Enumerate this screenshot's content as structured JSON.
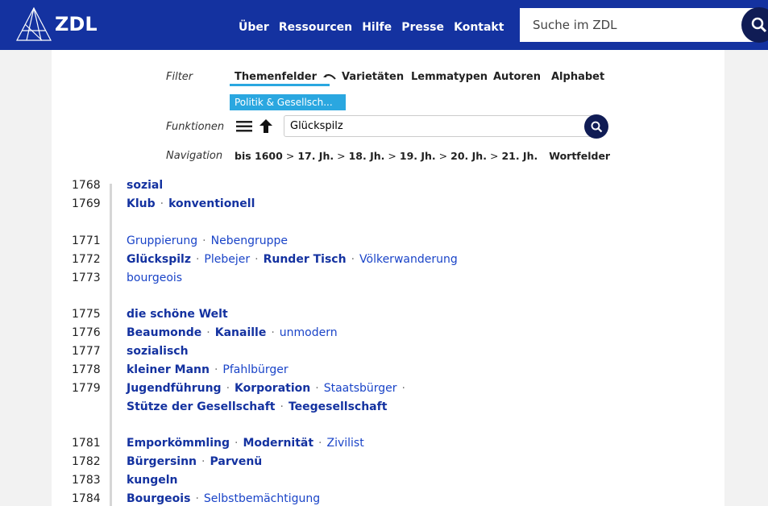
{
  "header": {
    "brand": "ZDL",
    "nav": [
      "Über",
      "Ressourcen",
      "Hilfe",
      "Presse",
      "Kontakt"
    ],
    "search_placeholder": "Suche im ZDL"
  },
  "filter": {
    "label": "Filter",
    "tabs": [
      "Themenfelder",
      "Varietäten",
      "Lemmatypen",
      "Autoren",
      "Alphabet"
    ],
    "active_chip": "Politik & Gesellsch..."
  },
  "functions": {
    "label": "Funktionen",
    "input_value": "Glückspilz"
  },
  "navigation": {
    "label": "Navigation",
    "items": [
      "bis 1600",
      "17. Jh.",
      "18. Jh.",
      "19. Jh.",
      "20. Jh.",
      "21. Jh.",
      "Wortfelder"
    ],
    "separator": ">"
  },
  "timeline": [
    {
      "year": "1768",
      "words": [
        {
          "t": "sozial",
          "b": true
        }
      ]
    },
    {
      "year": "1769",
      "words": [
        {
          "t": "Klub",
          "b": true
        },
        {
          "t": "konventionell",
          "b": true
        }
      ]
    },
    {
      "year": "1771",
      "words": [
        {
          "t": "Gruppierung",
          "b": false
        },
        {
          "t": "Nebengruppe",
          "b": false
        }
      ]
    },
    {
      "year": "1772",
      "words": [
        {
          "t": "Glückspilz",
          "b": true
        },
        {
          "t": "Plebejer",
          "b": false
        },
        {
          "t": "Runder Tisch",
          "b": true
        },
        {
          "t": "Völkerwanderung",
          "b": false
        }
      ]
    },
    {
      "year": "1773",
      "words": [
        {
          "t": "bourgeois",
          "b": false
        }
      ]
    },
    {
      "year": "1775",
      "words": [
        {
          "t": "die schöne Welt",
          "b": true
        }
      ]
    },
    {
      "year": "1776",
      "words": [
        {
          "t": "Beaumonde",
          "b": true
        },
        {
          "t": "Kanaille",
          "b": true
        },
        {
          "t": "unmodern",
          "b": false
        }
      ]
    },
    {
      "year": "1777",
      "words": [
        {
          "t": "sozialisch",
          "b": true
        }
      ]
    },
    {
      "year": "1778",
      "words": [
        {
          "t": "kleiner Mann",
          "b": true
        },
        {
          "t": "Pfahlbürger",
          "b": false
        }
      ]
    },
    {
      "year": "1779",
      "words": [
        {
          "t": "Jugendführung",
          "b": true
        },
        {
          "t": "Korporation",
          "b": true
        },
        {
          "t": "Staatsbürger",
          "b": false
        }
      ]
    },
    {
      "year": "",
      "words": [
        {
          "t": "Stütze der Gesellschaft",
          "b": true
        },
        {
          "t": "Teegesellschaft",
          "b": true
        }
      ]
    },
    {
      "year": "1781",
      "words": [
        {
          "t": "Emporkömmling",
          "b": true
        },
        {
          "t": "Modernität",
          "b": true
        },
        {
          "t": "Zivilist",
          "b": false
        }
      ]
    },
    {
      "year": "1782",
      "words": [
        {
          "t": "Bürgersinn",
          "b": true
        },
        {
          "t": "Parvenü",
          "b": true
        }
      ]
    },
    {
      "year": "1783",
      "words": [
        {
          "t": "kungeln",
          "b": true
        }
      ]
    },
    {
      "year": "1784",
      "words": [
        {
          "t": "Bourgeois",
          "b": true
        },
        {
          "t": "Selbstbemächtigung",
          "b": false
        }
      ]
    }
  ],
  "colors": {
    "header_bg": "#1432a0",
    "accent": "#2aa7e0",
    "link": "#1a44c8",
    "button_dark": "#101c55"
  }
}
